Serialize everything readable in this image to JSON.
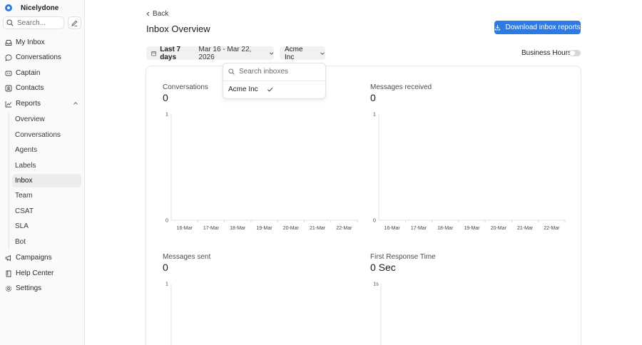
{
  "app": {
    "workspace_name": "Nicelydone"
  },
  "sidebar": {
    "search_placeholder": "Search...",
    "items": [
      {
        "label": "My Inbox",
        "icon": "inbox-icon"
      },
      {
        "label": "Conversations",
        "icon": "chat-bubble-icon"
      },
      {
        "label": "Captain",
        "icon": "captain-icon"
      },
      {
        "label": "Contacts",
        "icon": "contact-card-icon"
      },
      {
        "label": "Reports",
        "icon": "chart-line-icon",
        "expanded": true
      },
      {
        "label": "Campaigns",
        "icon": "megaphone-icon"
      },
      {
        "label": "Help Center",
        "icon": "book-icon"
      },
      {
        "label": "Settings",
        "icon": "gear-icon"
      }
    ],
    "report_sub_items": [
      {
        "label": "Overview"
      },
      {
        "label": "Conversations"
      },
      {
        "label": "Agents"
      },
      {
        "label": "Labels"
      },
      {
        "label": "Inbox",
        "active": true
      },
      {
        "label": "Team"
      },
      {
        "label": "CSAT"
      },
      {
        "label": "SLA"
      },
      {
        "label": "Bot"
      }
    ]
  },
  "header": {
    "back_label": "Back",
    "title": "Inbox Overview",
    "download_label": "Download inbox reports"
  },
  "filters": {
    "date_preset": "Last 7 days",
    "date_range": "Mar 16 - Mar 22, 2026",
    "inbox_selected": "Acme Inc",
    "business_hours_label": "Business Hours",
    "business_hours_enabled": false
  },
  "inbox_dropdown": {
    "search_placeholder": "Search inboxes",
    "options": [
      {
        "label": "Acme Inc",
        "selected": true
      }
    ]
  },
  "metrics": [
    {
      "title": "Conversations",
      "value": "0"
    },
    {
      "title": "Messages received",
      "value": "0"
    },
    {
      "title": "Messages sent",
      "value": "0"
    },
    {
      "title": "First Response Time",
      "value": "0 Sec"
    }
  ],
  "colors": {
    "accent": "#2c7be5",
    "active_nav_bg": "#ececec"
  },
  "chart_data": [
    {
      "type": "bar",
      "categories": [
        "16-Mar",
        "17-Mar",
        "18-Mar",
        "19-Mar",
        "20-Mar",
        "21-Mar",
        "22-Mar"
      ],
      "values": [
        0,
        0,
        0,
        0,
        0,
        0,
        0
      ],
      "y_ticks": [
        "1",
        "0"
      ],
      "ylim": [
        0,
        1
      ]
    },
    {
      "type": "bar",
      "categories": [
        "16-Mar",
        "17-Mar",
        "18-Mar",
        "19-Mar",
        "20-Mar",
        "21-Mar",
        "22-Mar"
      ],
      "values": [
        0,
        0,
        0,
        0,
        0,
        0,
        0
      ],
      "y_ticks": [
        "1",
        "0"
      ],
      "ylim": [
        0,
        1
      ]
    },
    {
      "type": "bar",
      "categories": [],
      "values": [],
      "y_ticks": [
        "1"
      ],
      "ylim": [
        0,
        1
      ]
    },
    {
      "type": "bar",
      "categories": [],
      "values": [],
      "y_ticks": [
        "1s"
      ],
      "ylim": [
        0,
        1
      ]
    }
  ]
}
